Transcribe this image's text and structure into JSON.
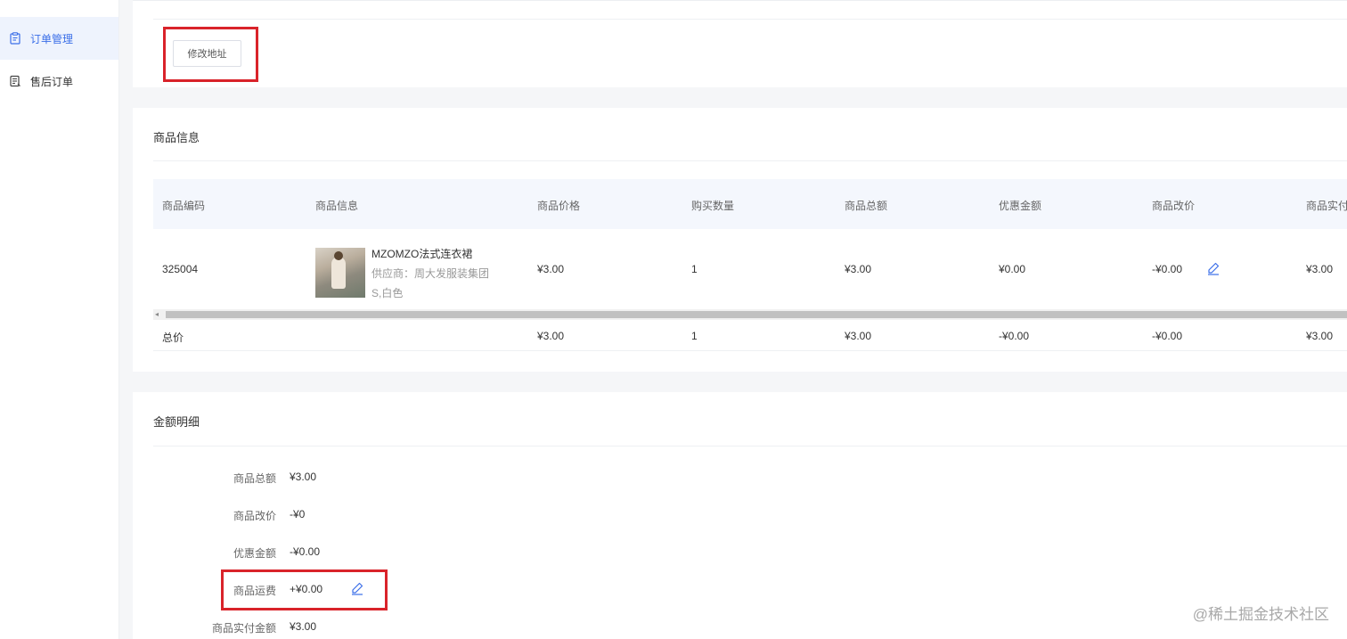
{
  "sidebar": {
    "items": [
      {
        "label": "订单管理",
        "icon": "clipboard-icon",
        "active": true
      },
      {
        "label": "售后订单",
        "icon": "document-icon",
        "active": false
      }
    ]
  },
  "address": {
    "modify_button": "修改地址"
  },
  "goods": {
    "title": "商品信息",
    "columns": [
      "商品编码",
      "商品信息",
      "商品价格",
      "购买数量",
      "商品总额",
      "优惠金额",
      "商品改价",
      "商品实付"
    ],
    "row": {
      "code": "325004",
      "name": "MZOMZO法式连衣裙",
      "supplier": "供应商：周大发服装集团",
      "sku": "S,白色",
      "price": "¥3.00",
      "quantity": "1",
      "total": "¥3.00",
      "discount": "¥0.00",
      "price_change": "-¥0.00",
      "paid": "¥3.00"
    },
    "footer": {
      "label": "总价",
      "price": "¥3.00",
      "quantity": "1",
      "total": "¥3.00",
      "discount": "-¥0.00",
      "price_change": "-¥0.00",
      "paid": "¥3.00"
    }
  },
  "amount": {
    "title": "金额明细",
    "rows": [
      {
        "label": "商品总额",
        "value": "¥3.00"
      },
      {
        "label": "商品改价",
        "value": "-¥0"
      },
      {
        "label": "优惠金额",
        "value": "-¥0.00"
      },
      {
        "label": "商品运费",
        "value": "+¥0.00"
      },
      {
        "label": "商品实付金额",
        "value": "¥3.00"
      }
    ]
  },
  "watermark": "@稀土掘金技术社区",
  "colors": {
    "accent": "#3a6ee8",
    "highlight": "#d9232a"
  }
}
